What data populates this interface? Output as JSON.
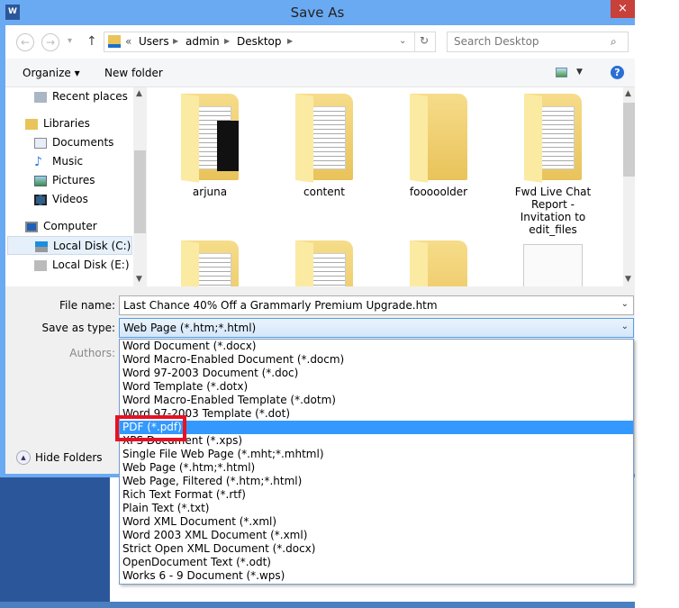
{
  "window": {
    "title": "Save As",
    "app_icon": "word-icon",
    "close": "×"
  },
  "nav": {
    "back": "←",
    "forward": "→",
    "recent": "▾",
    "up": "↑",
    "breadcrumb": [
      "«",
      "Users",
      "admin",
      "Desktop"
    ],
    "refresh": "↻",
    "search_placeholder": "Search Desktop"
  },
  "toolbar": {
    "organize": "Organize ▾",
    "new_folder": "New folder",
    "help": "?"
  },
  "sidebar": {
    "items": [
      {
        "label": "Recent places",
        "icon": "recent-places-icon"
      },
      {
        "label": "Libraries",
        "icon": "libraries-icon"
      },
      {
        "label": "Documents",
        "icon": "documents-icon"
      },
      {
        "label": "Music",
        "icon": "music-icon"
      },
      {
        "label": "Pictures",
        "icon": "pictures-icon"
      },
      {
        "label": "Videos",
        "icon": "videos-icon"
      },
      {
        "label": "Computer",
        "icon": "computer-icon"
      },
      {
        "label": "Local Disk (C:)",
        "icon": "disk-icon"
      },
      {
        "label": "Local Disk (E:)",
        "icon": "disk-icon"
      }
    ],
    "selected": "Local Disk (C:)"
  },
  "files": [
    {
      "name": "arjuna"
    },
    {
      "name": "content"
    },
    {
      "name": "fooooolder"
    },
    {
      "name": "Fwd Live Chat Report - Invitation to edit_files"
    },
    {
      "name": ""
    },
    {
      "name": ""
    },
    {
      "name": ""
    },
    {
      "name": ""
    }
  ],
  "form": {
    "file_name_label": "File name:",
    "file_name": "Last Chance 40% Off a Grammarly Premium Upgrade.htm",
    "type_label": "Save as type:",
    "type_value": "Web Page (*.htm;*.html)",
    "authors_label": "Authors:",
    "hide_folders": "Hide Folders"
  },
  "type_options": [
    "Word Document (*.docx)",
    "Word Macro-Enabled Document (*.docm)",
    "Word 97-2003 Document (*.doc)",
    "Word Template (*.dotx)",
    "Word Macro-Enabled Template (*.dotm)",
    "Word 97-2003 Template (*.dot)",
    "PDF (*.pdf)",
    "XPS Document (*.xps)",
    "Single File Web Page (*.mht;*.mhtml)",
    "Web Page (*.htm;*.html)",
    "Web Page, Filtered (*.htm;*.html)",
    "Rich Text Format (*.rtf)",
    "Plain Text (*.txt)",
    "Word XML Document (*.xml)",
    "Word 2003 XML Document (*.xml)",
    "Strict Open XML Document (*.docx)",
    "OpenDocument Text (*.odt)",
    "Works 6 - 9 Document (*.wps)"
  ],
  "highlighted_option": "PDF (*.pdf)",
  "colors": {
    "titlebar": "#6aaaf2",
    "close": "#c7403a",
    "highlight": "#3399ff",
    "annotation": "#e81123",
    "word_blue": "#2b579a"
  }
}
